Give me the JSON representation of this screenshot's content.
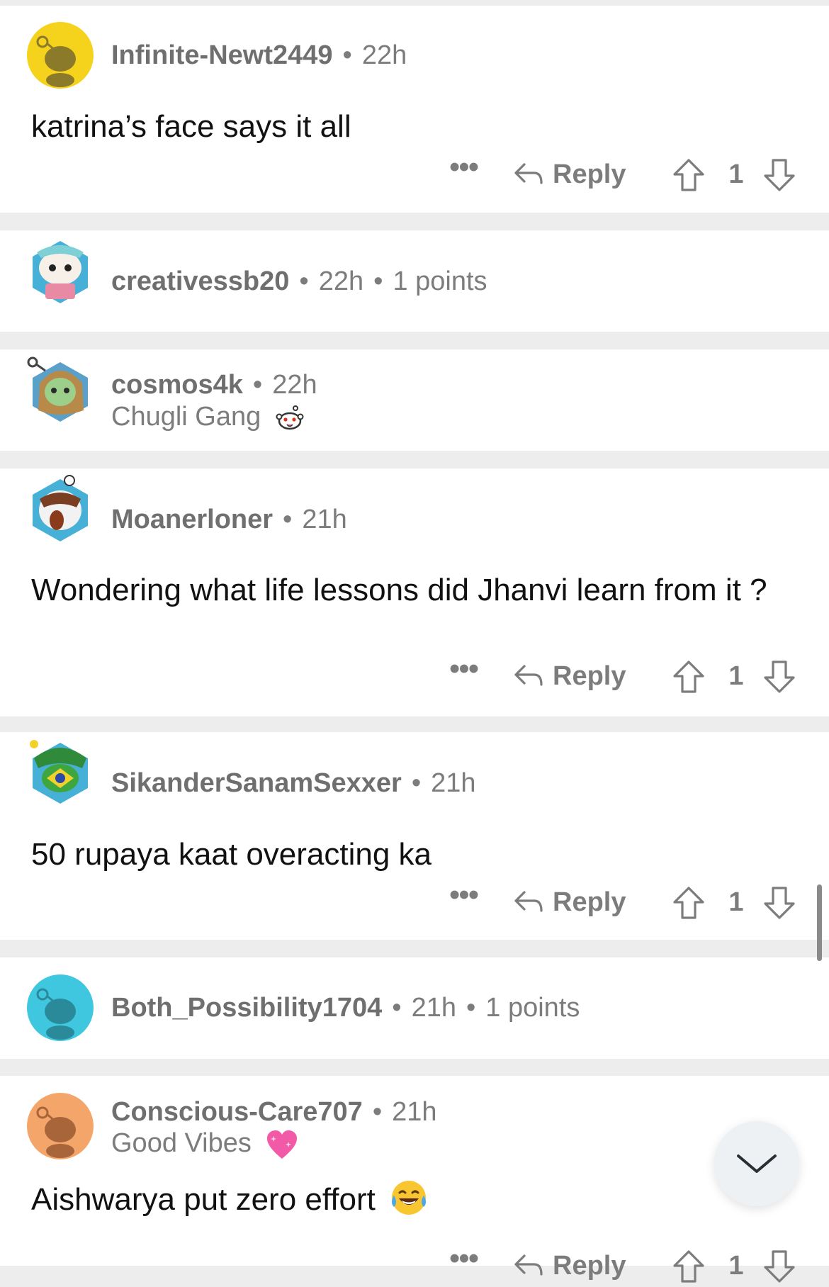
{
  "comments": [
    {
      "username": "Infinite-Newt2449",
      "time": "22h",
      "body": "katrina’s face says it all",
      "reply_label": "Reply",
      "more_label": "•••",
      "score": "1",
      "avatar_color": "#f5d21b"
    },
    {
      "username": "creativessb20",
      "time": "22h",
      "points": "1 points",
      "avatar_color": "#46b0d6"
    },
    {
      "username": "cosmos4k",
      "time": "22h",
      "flair": "Chugli Gang",
      "avatar_color": "#5aa0c8"
    },
    {
      "username": "Moanerloner",
      "time": "21h",
      "body": "Wondering what life lessons did Jhanvi learn from it ?",
      "reply_label": "Reply",
      "more_label": "•••",
      "score": "1",
      "avatar_color": "#46b0d6"
    },
    {
      "username": "SikanderSanamSexxer",
      "time": "21h",
      "body": "50 rupaya kaat overacting ka",
      "reply_label": "Reply",
      "more_label": "•••",
      "score": "1",
      "avatar_color": "#46b0d6"
    },
    {
      "username": "Both_Possibility1704",
      "time": "21h",
      "points": "1 points",
      "avatar_color": "#3fc7e0"
    },
    {
      "username": "Conscious-Care707",
      "time": "21h",
      "flair": "Good Vibes",
      "body": "Aishwarya put zero effort",
      "reply_label": "Reply",
      "more_label": "•••",
      "score": "1",
      "avatar_color": "#f4a66a"
    }
  ],
  "separator": "•",
  "accent_gray": "#7c7c7c"
}
